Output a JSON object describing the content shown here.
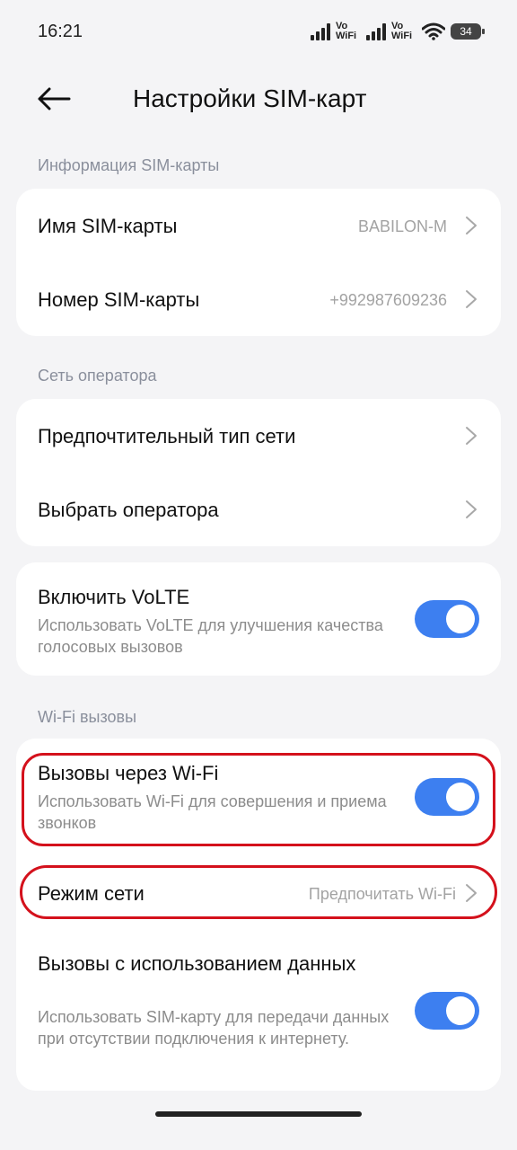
{
  "status_bar": {
    "time": "16:21",
    "vowifi_label": "Vo\nWiFi",
    "battery": "34"
  },
  "header": {
    "back_icon": "arrow-left-icon",
    "title": "Настройки SIM-карт"
  },
  "sections": {
    "sim_info": {
      "title": "Информация SIM-карты",
      "sim_name_label": "Имя SIM-карты",
      "sim_name_value": "BABILON-M",
      "sim_number_label": "Номер SIM-карты",
      "sim_number_value": "+992987609236"
    },
    "operator": {
      "title": "Сеть оператора",
      "preferred_network_label": "Предпочтительный тип сети",
      "choose_operator_label": "Выбрать оператора"
    },
    "volte": {
      "title": "Включить VoLTE",
      "subtitle": "Использовать VoLTE для улучшения качества голосовых вызовов",
      "enabled": true
    },
    "wifi_calls": {
      "title": "Wi-Fi вызовы",
      "wifi_calling_label": "Вызовы через Wi-Fi",
      "wifi_calling_subtitle": "Использовать Wi-Fi для совершения и приема звонков",
      "wifi_calling_enabled": true,
      "network_mode_label": "Режим сети",
      "network_mode_value": "Предпочитать Wi-Fi",
      "data_calls_label": "Вызовы с использованием данных",
      "data_calls_subtitle": "Использовать SIM-карту для передачи данных при отсутствии подключения к интернету.",
      "data_calls_enabled": true
    }
  },
  "colors": {
    "accent": "#3d7ff0",
    "highlight": "#d4111c",
    "background": "#f4f4f6"
  }
}
